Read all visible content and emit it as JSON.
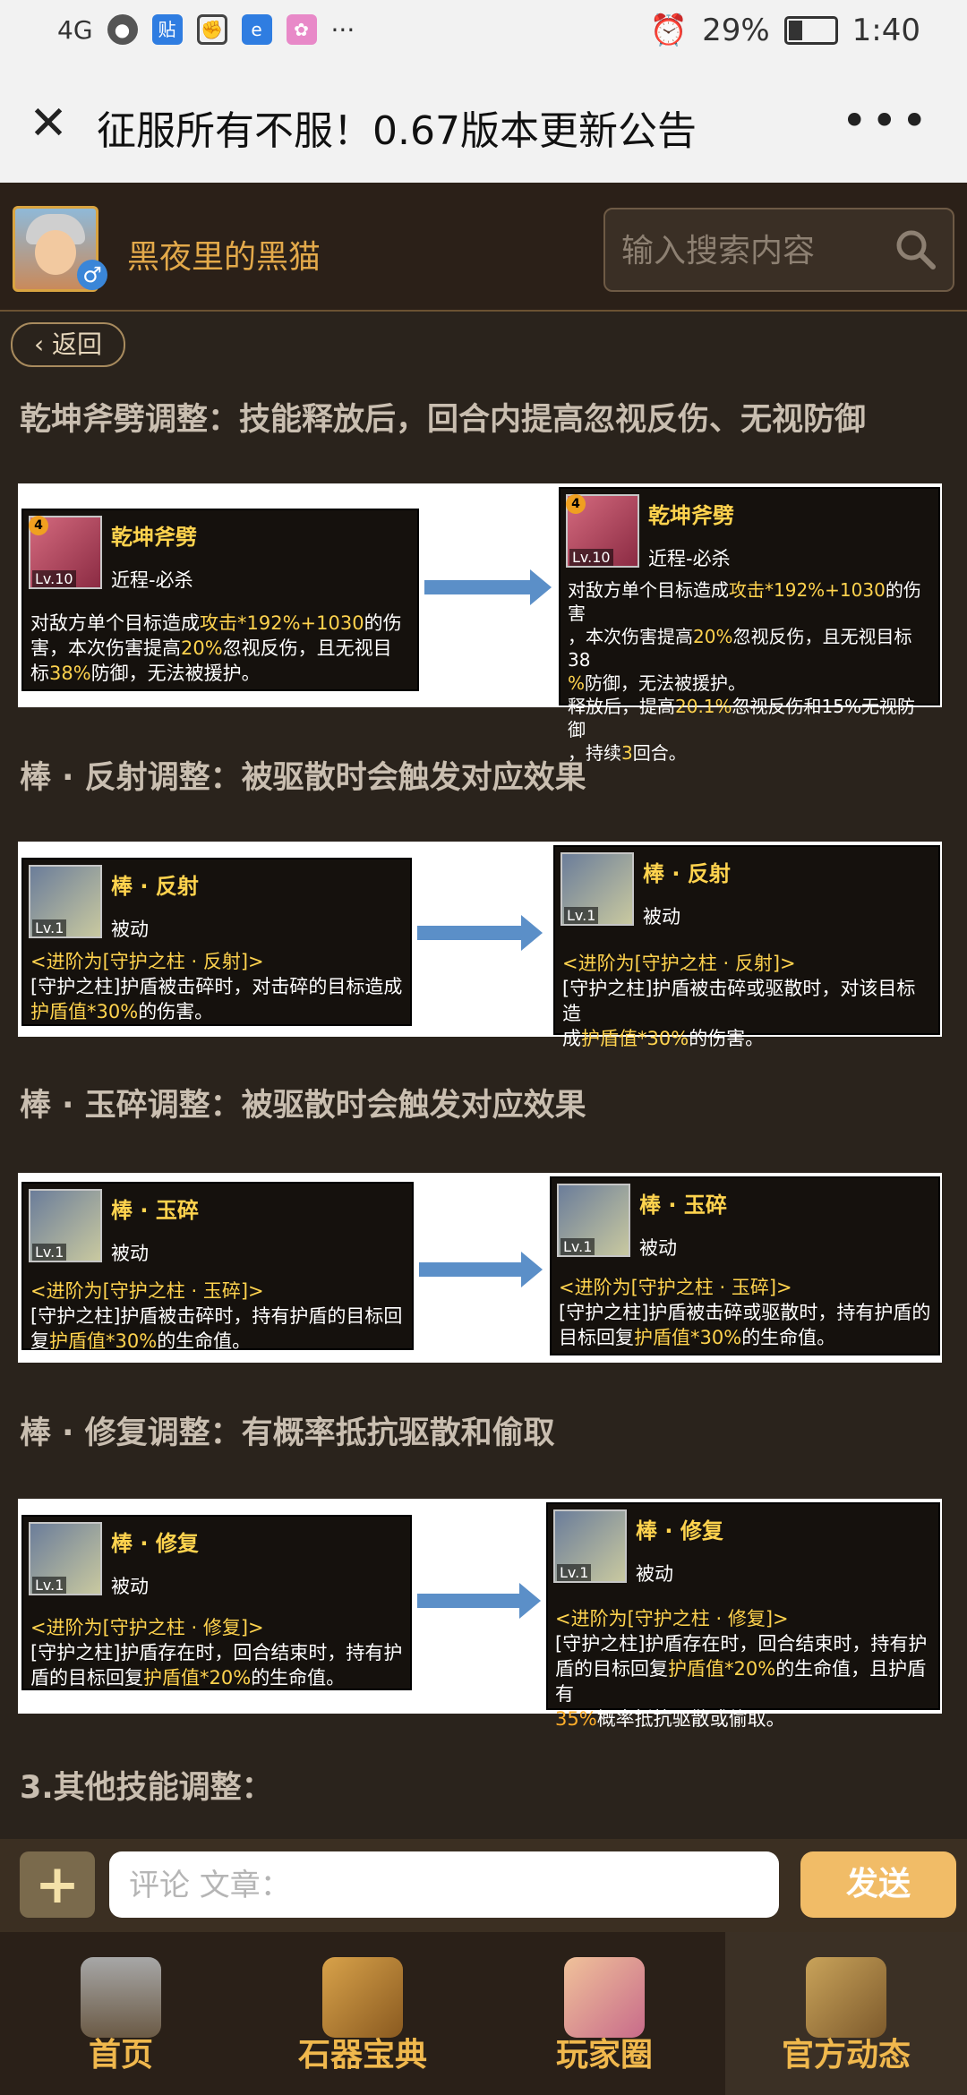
{
  "status_bar": {
    "network": "4G",
    "battery": "29%",
    "time": "1:40",
    "app_icons": [
      "shield-icon",
      "baidu-icon",
      "fist-icon",
      "browser-icon",
      "flower-icon"
    ],
    "ellipsis": "···"
  },
  "title_bar": {
    "title": "征服所有不服！0.67版本更新公告",
    "more": "•••"
  },
  "user": {
    "name": "黑夜里的黑猫",
    "gender_symbol": "♂"
  },
  "search": {
    "placeholder": "输入搜索内容"
  },
  "back": {
    "label": "返回"
  },
  "sections": [
    {
      "heading": "乾坤斧劈调整：技能释放后，回合内提高忽视反伤、无视防御",
      "before": {
        "level": "Lv.10",
        "badge": "4",
        "name": "乾坤斧劈",
        "type": "近程-必杀",
        "lines": [
          [
            "对敌方单个目标造成",
            "攻击*192%+1030",
            "的伤"
          ],
          [
            "害，本次伤害提高",
            "20%",
            "忽视反伤，且无视目"
          ],
          [
            "标",
            "38%",
            "防御，无法被援护。"
          ]
        ]
      },
      "after": {
        "level": "Lv.10",
        "badge": "4",
        "name": "乾坤斧劈",
        "type": "近程-必杀",
        "lines": [
          [
            "对敌方单个目标造成",
            "攻击*192%+1030",
            "的伤害"
          ],
          [
            "，本次伤害提高",
            "20%",
            "忽视反伤，且无视目标38"
          ],
          [
            "",
            "%",
            "防御，无法被援护。"
          ],
          [
            "释放后，提高",
            "20.1%",
            "忽视反伤和15%无视防御"
          ],
          [
            "，持续",
            "3",
            "回合。"
          ]
        ]
      }
    },
    {
      "heading": "棒 · 反射调整：被驱散时会触发对应效果",
      "before": {
        "level": "Lv.1",
        "name": "棒 · 反射",
        "type": "被动",
        "advance": "<进阶为[守护之柱 · 反射]>",
        "lines": [
          [
            "[守护之柱]护盾被击碎时，对击碎的目标造成",
            "",
            ""
          ],
          [
            "",
            "护盾值*30%",
            "的伤害。"
          ]
        ]
      },
      "after": {
        "level": "Lv.1",
        "name": "棒 · 反射",
        "type": "被动",
        "advance": "<进阶为[守护之柱 · 反射]>",
        "lines": [
          [
            "[守护之柱]护盾被击碎或驱散时，对该目标造",
            "",
            ""
          ],
          [
            "成",
            "护盾值*30%",
            "的伤害。"
          ]
        ]
      }
    },
    {
      "heading": "棒 · 玉碎调整：被驱散时会触发对应效果",
      "before": {
        "level": "Lv.1",
        "name": "棒 · 玉碎",
        "type": "被动",
        "advance": "<进阶为[守护之柱 · 玉碎]>",
        "lines": [
          [
            "[守护之柱]护盾被击碎时，持有护盾的目标回",
            "",
            ""
          ],
          [
            "复",
            "护盾值*30%",
            "的生命值。"
          ]
        ]
      },
      "after": {
        "level": "Lv.1",
        "name": "棒 · 玉碎",
        "type": "被动",
        "advance": "<进阶为[守护之柱 · 玉碎]>",
        "lines": [
          [
            "[守护之柱]护盾被击碎或驱散时，持有护盾的",
            "",
            ""
          ],
          [
            "目标回复",
            "护盾值*30%",
            "的生命值。"
          ]
        ]
      }
    },
    {
      "heading": "棒 · 修复调整：有概率抵抗驱散和偷取",
      "before": {
        "level": "Lv.1",
        "name": "棒 · 修复",
        "type": "被动",
        "advance": "<进阶为[守护之柱 · 修复]>",
        "lines": [
          [
            "[守护之柱]护盾存在时，回合结束时，持有护",
            "",
            ""
          ],
          [
            "盾的目标回复",
            "护盾值*20%",
            "的生命值。"
          ]
        ]
      },
      "after": {
        "level": "Lv.1",
        "name": "棒 · 修复",
        "type": "被动",
        "advance": "<进阶为[守护之柱 · 修复]>",
        "lines": [
          [
            "[守护之柱]护盾存在时，回合结束时，持有护",
            "",
            ""
          ],
          [
            "盾的目标回复",
            "护盾值*20%",
            "的生命值，且护盾有"
          ],
          [
            "",
            "35%",
            "概率抵抗驱散或偷取。"
          ]
        ]
      }
    }
  ],
  "other_heading": "3.其他技能调整：",
  "comment": {
    "add_symbol": "+",
    "placeholder": "评论 文章：",
    "send_label": "发送"
  },
  "nav": [
    {
      "label": "首页",
      "icon": "castle-icon"
    },
    {
      "label": "石器宝典",
      "icon": "scroll-icon"
    },
    {
      "label": "玩家圈",
      "icon": "players-icon"
    },
    {
      "label": "官方动态",
      "icon": "parchment-icon"
    }
  ]
}
